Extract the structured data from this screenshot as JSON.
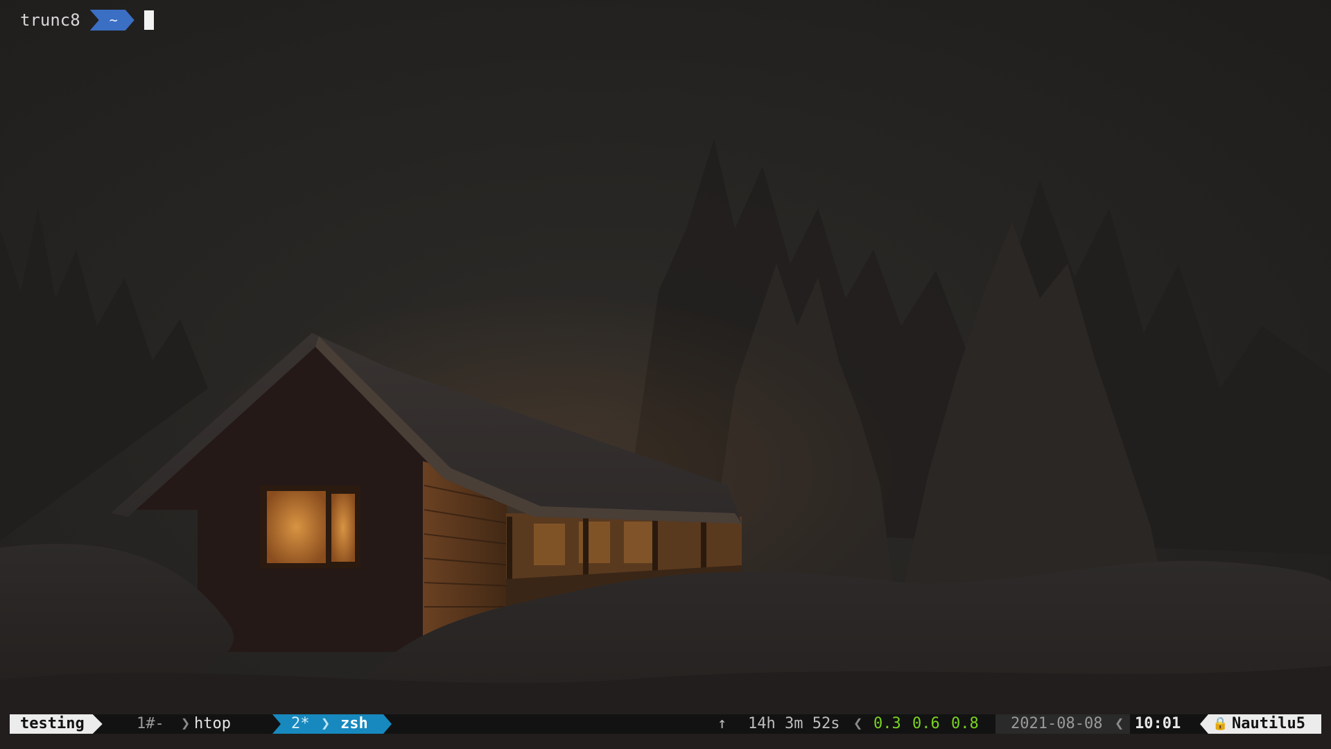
{
  "prompt": {
    "host": "trunc8",
    "cwd": "~"
  },
  "statusbar": {
    "session": "testing",
    "windows": [
      {
        "index": "1#-",
        "name": "htop",
        "active": false
      },
      {
        "index": "2*",
        "name": "zsh",
        "active": true
      }
    ],
    "uptime_arrow": "↑",
    "uptime": "14h 3m 52s",
    "load": [
      "0.3",
      "0.6",
      "0.8"
    ],
    "date": "2021-08-08",
    "time": "10:01",
    "lock_icon": "🔒",
    "hostname": "Nautilu5"
  },
  "colors": {
    "status_bg": "#121212",
    "session_bg": "#ececec",
    "active_window_bg": "#1789bf",
    "prompt_dir_bg": "#3b6fc4",
    "load_fg": "#7bd321"
  }
}
